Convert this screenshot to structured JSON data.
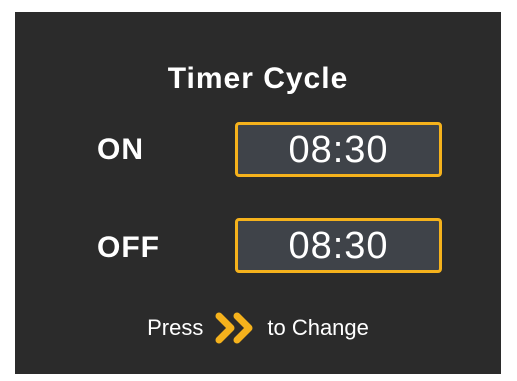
{
  "screen": {
    "title": "Timer Cycle",
    "on": {
      "label": "ON",
      "value": "08:30"
    },
    "off": {
      "label": "OFF",
      "value": "08:30"
    },
    "hint": {
      "prefix": "Press",
      "icon": "double-chevron-right-icon",
      "suffix": "to Change"
    }
  },
  "colors": {
    "background": "#2b2b2b",
    "accent": "#f5b21c",
    "field_fill": "#3f4349",
    "text": "#ffffff"
  }
}
